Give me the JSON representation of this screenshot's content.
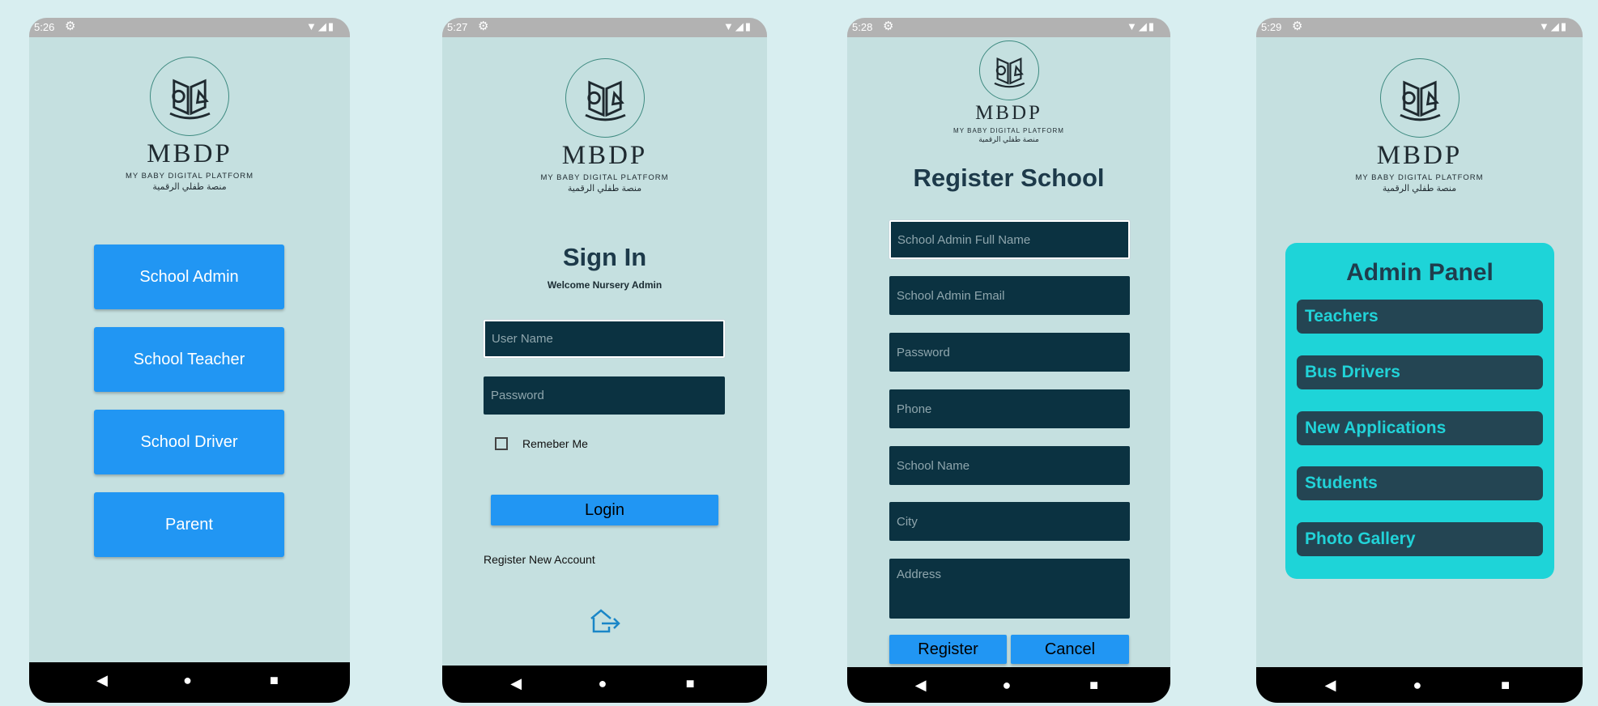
{
  "logo": {
    "name": "MBDP",
    "tagline": "MY BABY DIGITAL PLATFORM",
    "arabic": "منصة طفلي الرقمية"
  },
  "screen1": {
    "time": "5:26",
    "buttons": [
      "School Admin",
      "School Teacher",
      "School Driver",
      "Parent"
    ]
  },
  "screen2": {
    "time": "5:27",
    "title": "Sign In",
    "subtitle": "Welcome Nursery Admin",
    "username_placeholder": "User Name",
    "password_placeholder": "Password",
    "remember_label": "Remeber Me",
    "login_label": "Login",
    "register_link": "Register New Account"
  },
  "screen3": {
    "time": "5:28",
    "title": "Register School",
    "fields": [
      "School Admin Full Name",
      "School Admin Email",
      "Password",
      "Phone",
      "School Name",
      "City",
      "Address"
    ],
    "register_label": "Register",
    "cancel_label": "Cancel"
  },
  "screen4": {
    "time": "5:29",
    "panel_title": "Admin Panel",
    "items": [
      "Teachers",
      "Bus Drivers",
      "New Applications",
      "Students",
      "Photo Gallery"
    ]
  },
  "status_icons": "▼◢▮",
  "nav": {
    "back": "◀",
    "home": "●",
    "recent": "■"
  },
  "colors": {
    "accent": "#2196f3",
    "field": "#0b3241",
    "panel": "#1ed4d8",
    "background": "#c5e0e0"
  },
  "icons": {
    "gear": "gear-icon",
    "logout": "logout-icon",
    "logo": "book-scale-logo-icon"
  }
}
